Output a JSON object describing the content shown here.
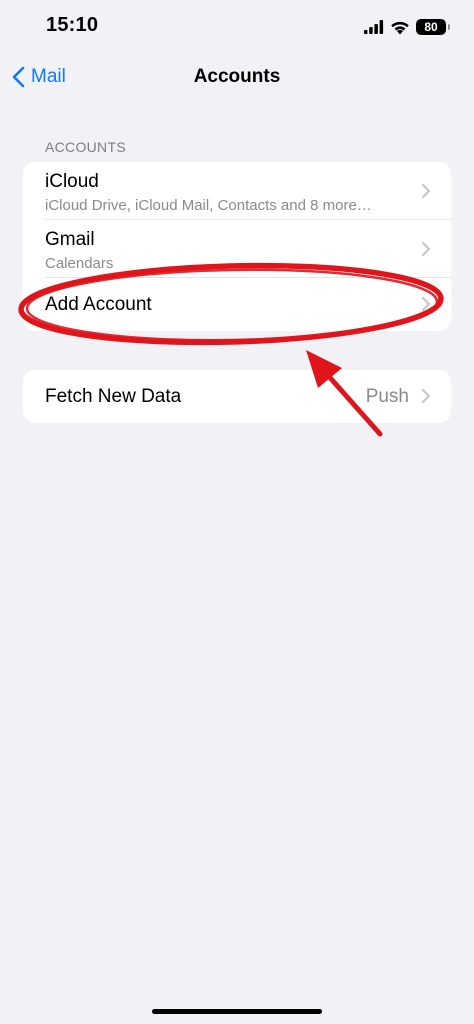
{
  "status_bar": {
    "time": "15:10",
    "battery_level": "80"
  },
  "nav": {
    "back_label": "Mail",
    "title": "Accounts"
  },
  "accounts_section": {
    "header": "ACCOUNTS",
    "rows": [
      {
        "title": "iCloud",
        "subtitle": "iCloud Drive, iCloud Mail, Contacts and 8 more…"
      },
      {
        "title": "Gmail",
        "subtitle": "Calendars"
      },
      {
        "title": "Add Account"
      }
    ]
  },
  "fetch_section": {
    "title": "Fetch New Data",
    "value": "Push"
  },
  "colors": {
    "accent": "#0a7aff",
    "background": "#f2f1f6",
    "annotation": "#e0141b"
  },
  "icons": {
    "back": "chevron-left-icon",
    "disclosure": "chevron-right-icon",
    "signal": "cellular-signal-icon",
    "wifi": "wifi-icon",
    "battery": "battery-icon"
  }
}
